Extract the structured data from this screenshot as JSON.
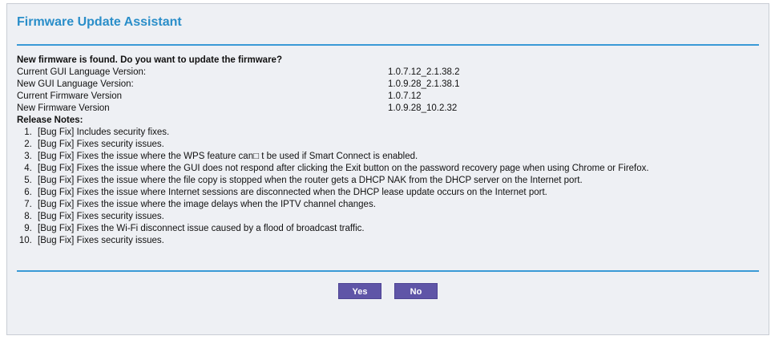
{
  "panel": {
    "title": "Firmware Update Assistant"
  },
  "update": {
    "question": "New firmware is found. Do you want to update the firmware?",
    "versions": [
      {
        "label": "Current GUI Language Version:",
        "value": "1.0.7.12_2.1.38.2"
      },
      {
        "label": "New GUI Language Version:",
        "value": "1.0.9.28_2.1.38.1"
      },
      {
        "label": "Current Firmware Version",
        "value": "1.0.7.12"
      },
      {
        "label": "New Firmware Version",
        "value": "1.0.9.28_10.2.32"
      }
    ],
    "notes_heading": "Release Notes:",
    "notes": [
      "[Bug Fix] Includes security fixes.",
      "[Bug Fix] Fixes security issues.",
      "[Bug Fix] Fixes the issue where the WPS feature can□ t be used if Smart Connect is enabled.",
      "[Bug Fix] Fixes the issue where the GUI does not respond after clicking the Exit button on the password recovery page when using Chrome or Firefox.",
      "[Bug Fix] Fixes the issue where the file copy is stopped when the router gets a DHCP NAK from the DHCP server on the Internet port.",
      "[Bug Fix] Fixes the issue where Internet sessions are disconnected when the DHCP lease update occurs on the Internet port.",
      "[Bug Fix] Fixes the issue where the image delays when the IPTV channel changes.",
      "[Bug Fix] Fixes security issues.",
      "[Bug Fix] Fixes the Wi-Fi disconnect issue caused by a flood of broadcast traffic.",
      "[Bug Fix] Fixes security issues."
    ]
  },
  "actions": {
    "yes_label": "Yes",
    "no_label": "No"
  },
  "colors": {
    "title": "#2a8ec9",
    "rule": "#3a9ad6",
    "button": "#5f55a7",
    "panel_bg": "#eef0f4"
  }
}
